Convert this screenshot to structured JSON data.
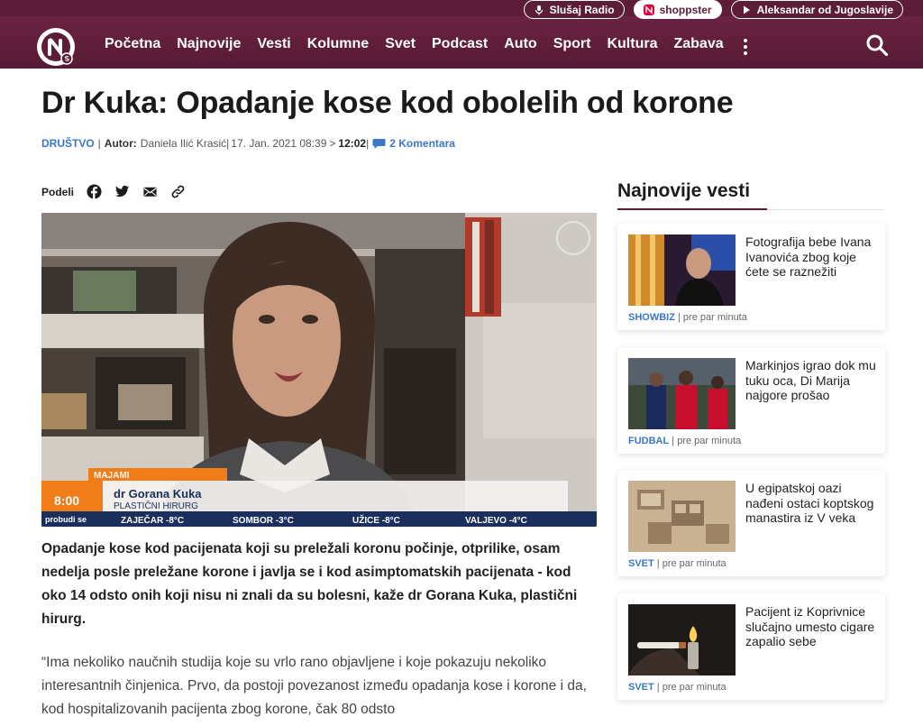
{
  "header": {
    "pills": {
      "radio": "Slušaj Radio",
      "shop": "shoppster",
      "live": "Aleksandar od Jugoslavije"
    },
    "nav": [
      "Početna",
      "Najnovije",
      "Vesti",
      "Kolumne",
      "Svet",
      "Podcast",
      "Auto",
      "Sport",
      "Kultura",
      "Zabava"
    ],
    "brand_color": "#5c1d38"
  },
  "article": {
    "title": "Dr Kuka: Opadanje kose kod obolelih od korone",
    "category": "DRUŠTVO",
    "author_label": "Autor:",
    "author": "Daniela Ilić Krasić",
    "date": "17. Jan. 2021 08:39",
    "arrow": ">",
    "updated": "12:02",
    "comments": "2 Komentara",
    "share_label": "Podeli",
    "video": {
      "location": "MAJAMI",
      "clock": "8:00",
      "show": "probudi se",
      "name": "dr Gorana Kuka",
      "role": "PLASTIČNI HIRURG",
      "weather": [
        "ZAJEČAR -8°C",
        "SOMBOR -3°C",
        "UŽICE -8°C",
        "VALJEVO -4°C"
      ]
    },
    "lead": "Opadanje kose kod pacijenata koji su preležali koronu počinje, otprilike, osam nedelja posle preležane korone i javlja se i kod asimptomatskih pacijenata - kod oko 14 odsto onih koji nisu ni znali da su bolesni, kaže dr Gorana Kuka, plastični hirurg.",
    "body": "“Ima nekoliko naučnih studija koje su vrlo rano objavljene i koje pokazuju nekoliko interesantnih činjenica. Prvo, da postoji povezanost između opadanja kose i korone i da, kod hospitalizovanih pacijenta zbog korone, čak 80 odsto"
  },
  "sidebar": {
    "title": "Najnovije vesti",
    "items": [
      {
        "headline": "Fotografija bebe Ivana Ivanovića zbog koje ćete se raznežiti",
        "section": "SHOWBIZ",
        "time": "| pre par minuta"
      },
      {
        "headline": "Markinjos igrao dok mu tuku oca, Di Marija najgore prošao",
        "section": "FUDBAL",
        "time": "| pre par minuta"
      },
      {
        "headline": "U egipatskoj oazi nađeni ostaci koptskog manastira iz V veka",
        "section": "SVET",
        "time": "| pre par minuta"
      },
      {
        "headline": "Pacijent iz Koprivnice slučajno umesto cigare zapalio sebe",
        "section": "SVET",
        "time": "| pre par minuta"
      }
    ]
  }
}
